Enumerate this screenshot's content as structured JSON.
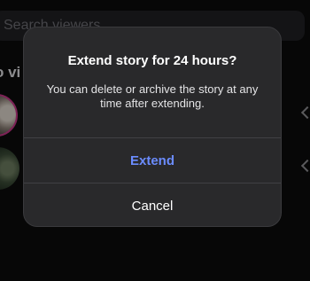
{
  "search": {
    "placeholder": "Search viewers"
  },
  "section": {
    "header": "o vi"
  },
  "dialog": {
    "title": "Extend story for 24 hours?",
    "message": "You can delete or archive the story at any time after extending.",
    "primary_label": "Extend",
    "cancel_label": "Cancel"
  },
  "colors": {
    "accent": "#6b8cff",
    "dialog_bg": "#29292b",
    "story_ring": "#c13584"
  }
}
